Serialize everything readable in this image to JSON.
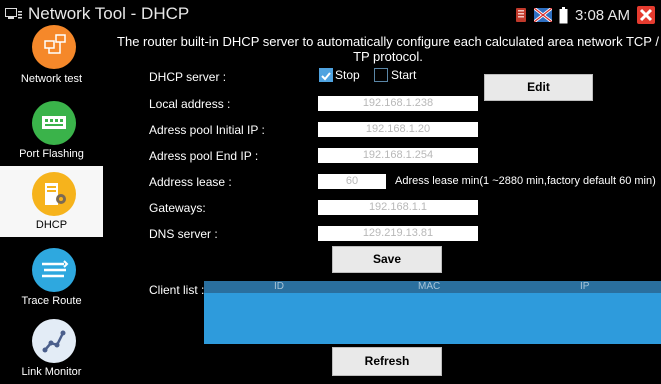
{
  "title": "Network Tool - DHCP",
  "status": {
    "time": "3:08 AM"
  },
  "sidebar": {
    "items": [
      {
        "label": "Network test",
        "color": "#f5882a"
      },
      {
        "label": "Port Flashing",
        "color": "#3ab34a"
      },
      {
        "label": "DHCP",
        "color": "#f6b31c",
        "active": true
      },
      {
        "label": "Trace Route",
        "color": "#2ea8df"
      },
      {
        "label": "Link Monitor",
        "color": "#e3ecf6"
      }
    ]
  },
  "description": "The router built-in DHCP server to automatically configure each calculated area network TCP / TP protocol.",
  "form": {
    "dhcp_server_label": "DHCP server :",
    "stop_label": "Stop",
    "start_label": "Start",
    "stop_checked": true,
    "start_checked": false,
    "edit_label": "Edit",
    "local_address_label": "Local address :",
    "local_address_value": "192.168.1.238",
    "pool_initial_label": "Adress pool Initial IP :",
    "pool_initial_value": "192.168.1.20",
    "pool_end_label": "Adress pool End IP :",
    "pool_end_value": "192.168.1.254",
    "lease_label": "Address lease :",
    "lease_value": "60",
    "lease_note": "Adress lease min(1 ~2880 min,factory default 60 min)",
    "gateways_label": "Gateways:",
    "gateways_value": "192.168.1.1",
    "dns_label": "DNS server :",
    "dns_value": "129.219.13.81",
    "save_label": "Save"
  },
  "client_list": {
    "label": "Client list :",
    "columns": [
      "ID",
      "MAC",
      "IP"
    ],
    "rows": []
  },
  "refresh_label": "Refresh",
  "colors": {
    "accent": "#2e9bdc",
    "table_header": "#2a6f9e",
    "close": "#e53b2f"
  }
}
